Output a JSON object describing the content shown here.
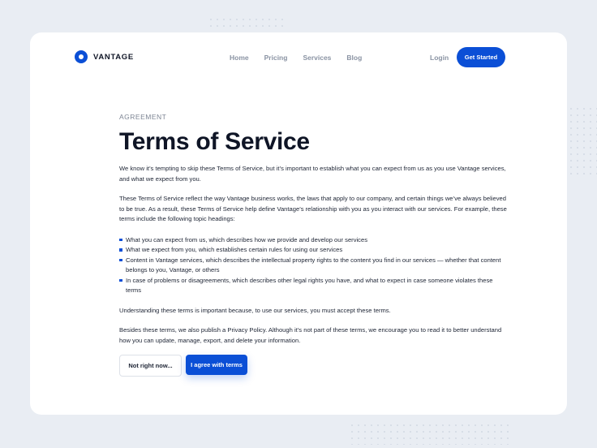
{
  "brand": {
    "name": "VANTAGE",
    "accent": "#0b4fd6"
  },
  "nav": {
    "items": [
      {
        "label": "Home"
      },
      {
        "label": "Pricing"
      },
      {
        "label": "Services"
      },
      {
        "label": "Blog"
      }
    ],
    "login_label": "Login",
    "cta_label": "Get Started"
  },
  "content": {
    "eyebrow": "AGREEMENT",
    "title": "Terms of Service",
    "intro": "We know it’s tempting to skip these Terms of Service, but it’s important to establish what you can expect from us as you use Vantage services, and what we expect from you.",
    "para2": "These Terms of Service reflect the way Vantage business works, the laws that apply to our company, and certain things we’ve always believed to be true. As a result, these Terms of Service help define Vantage’s relationship with you as you interact with our services. For example, these terms include the following topic headings:",
    "bullets": [
      "What you can expect from us, which describes how we provide and develop our services",
      "What we expect from you, which establishes certain rules for using our services",
      "Content in Vantage services, which describes the intellectual property rights to the content you find in our services — whether that content belongs to you, Vantage, or others",
      "In case of problems or disagreements, which describes other legal rights you have, and what to expect in case someone violates these terms"
    ],
    "para3": "Understanding these terms is important because, to use our services, you must accept these terms.",
    "para4": "Besides these terms, we also publish a Privacy Policy. Although it’s not part of these terms, we encourage you to read it to better understand how you can update, manage, export, and delete your information."
  },
  "actions": {
    "decline_label": "Not right now...",
    "agree_label": "I agree with terms"
  }
}
